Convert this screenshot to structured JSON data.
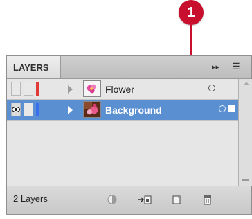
{
  "callout": {
    "number": "1"
  },
  "panel": {
    "tab_title": "LAYERS",
    "collapse_glyph": "▸▸",
    "menu_glyph": "☰"
  },
  "layers": [
    {
      "name": "Flower",
      "selected": false,
      "visible": false,
      "color": "#e03a3a"
    },
    {
      "name": "Background",
      "selected": true,
      "visible": true,
      "color": "#3c6ff0"
    }
  ],
  "footer": {
    "count_label": "2 Layers"
  },
  "icons": [
    "eye-icon",
    "disclosure-triangle-icon",
    "target-circle-icon",
    "make-clipping-mask-icon",
    "new-sublayer-icon",
    "new-layer-icon",
    "delete-layer-icon",
    "panel-menu-icon"
  ]
}
